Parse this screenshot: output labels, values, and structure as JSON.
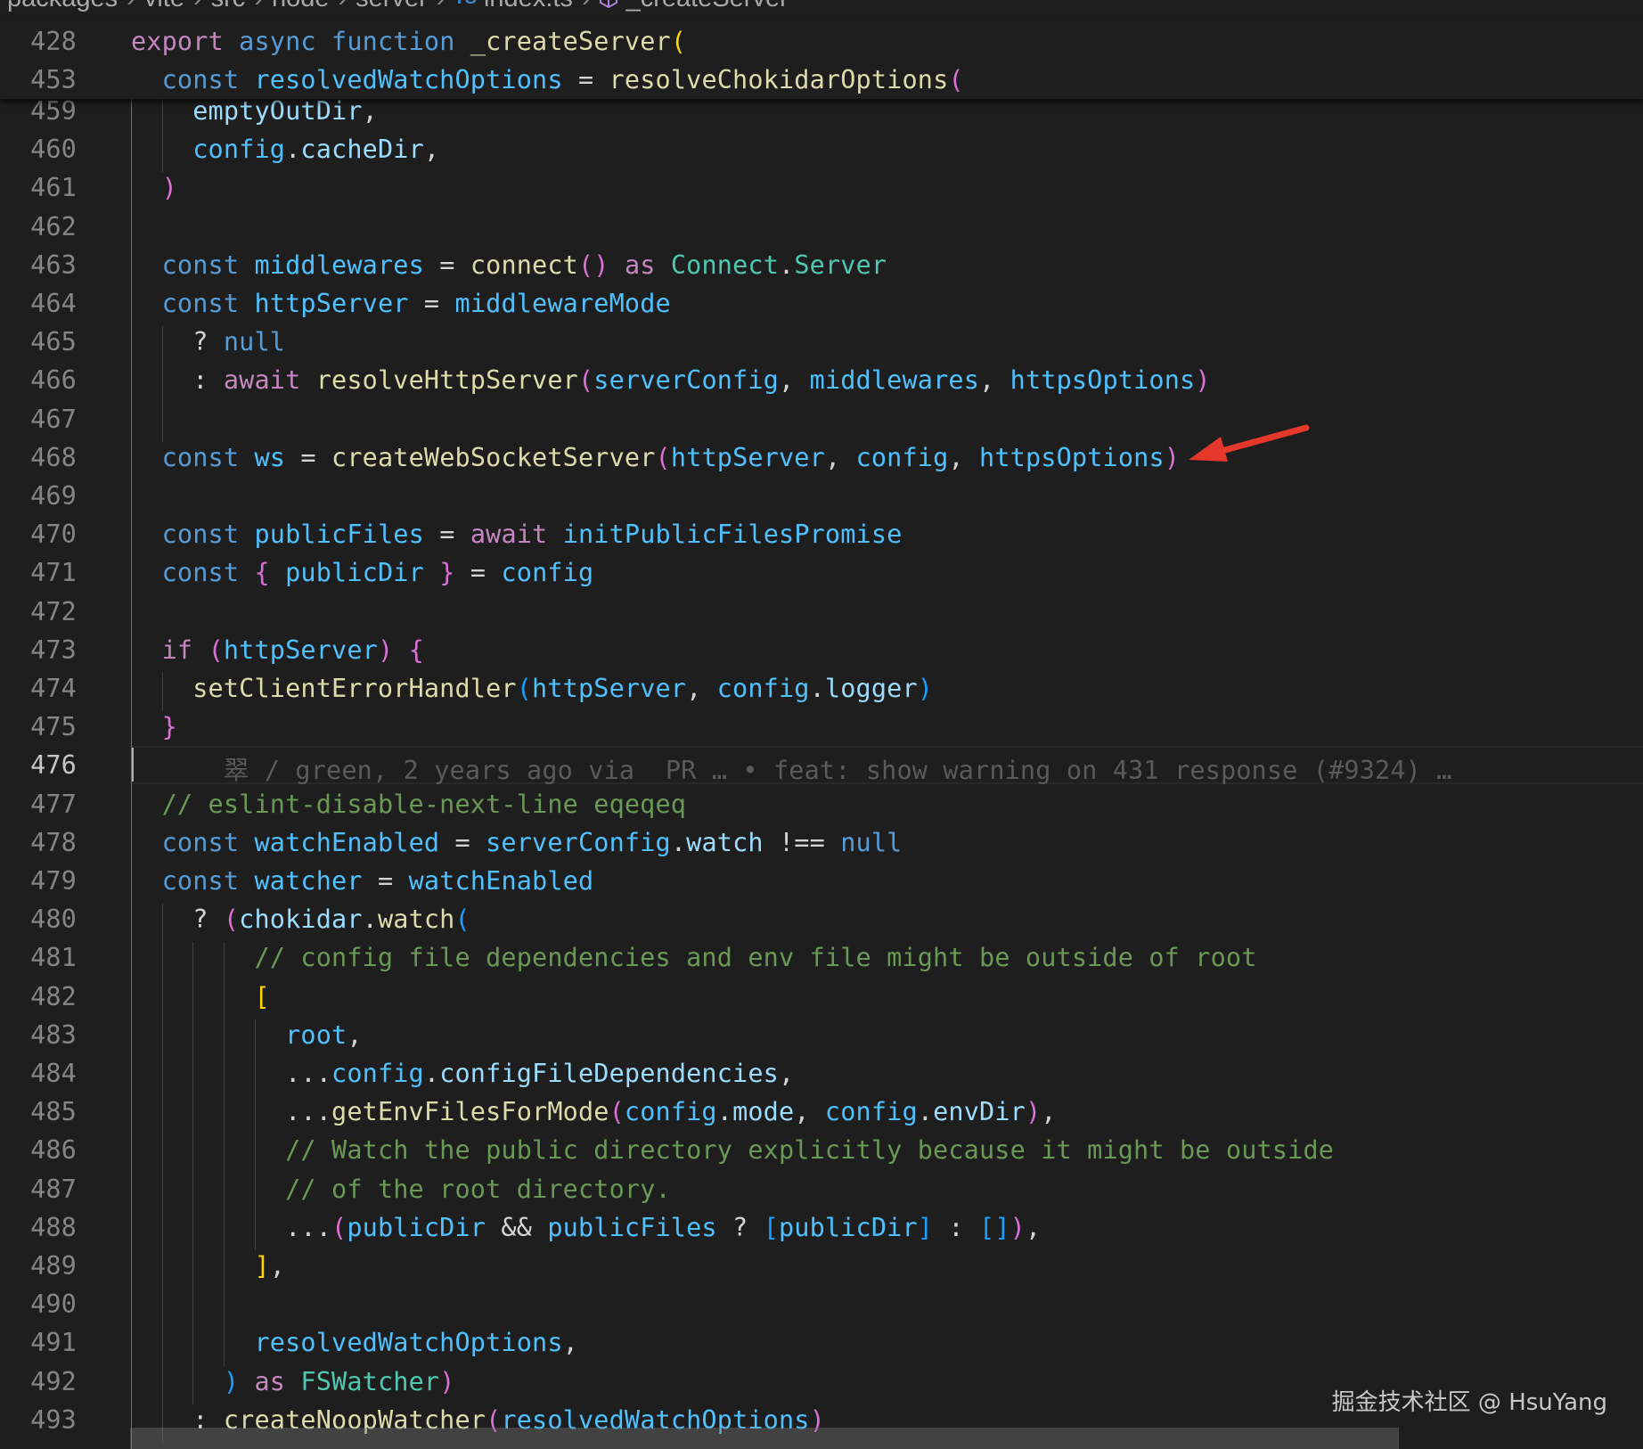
{
  "breadcrumb": {
    "segments": [
      "packages",
      "vite",
      "src",
      "node",
      "server"
    ],
    "ts_badge": "TS",
    "file": "index.ts",
    "symbol": "_createServer"
  },
  "sticky": [
    {
      "num": "428",
      "tokens": [
        [
          "ctl",
          "export"
        ],
        [
          "op",
          " "
        ],
        [
          "kw",
          "async"
        ],
        [
          "op",
          " "
        ],
        [
          "kw",
          "function"
        ],
        [
          "op",
          " "
        ],
        [
          "fn",
          "_createServer"
        ],
        [
          "b1",
          "("
        ]
      ]
    },
    {
      "num": "453",
      "tokens": [
        [
          "op",
          "  "
        ],
        [
          "kw",
          "const"
        ],
        [
          "op",
          " "
        ],
        [
          "cv",
          "resolvedWatchOptions"
        ],
        [
          "op",
          " = "
        ],
        [
          "fn",
          "resolveChokidarOptions"
        ],
        [
          "b2",
          "("
        ]
      ]
    }
  ],
  "lines": [
    {
      "num": "459",
      "tokens": [
        [
          "op",
          "    "
        ],
        [
          "v",
          "emptyOutDir"
        ],
        [
          "op",
          ","
        ]
      ]
    },
    {
      "num": "460",
      "tokens": [
        [
          "op",
          "    "
        ],
        [
          "cv",
          "config"
        ],
        [
          "op",
          "."
        ],
        [
          "v",
          "cacheDir"
        ],
        [
          "op",
          ","
        ]
      ]
    },
    {
      "num": "461",
      "tokens": [
        [
          "op",
          "  "
        ],
        [
          "b2",
          ")"
        ]
      ]
    },
    {
      "num": "462",
      "tokens": []
    },
    {
      "num": "463",
      "tokens": [
        [
          "op",
          "  "
        ],
        [
          "kw",
          "const"
        ],
        [
          "op",
          " "
        ],
        [
          "cv",
          "middlewares"
        ],
        [
          "op",
          " = "
        ],
        [
          "fn",
          "connect"
        ],
        [
          "b2",
          "()"
        ],
        [
          "op",
          " "
        ],
        [
          "ctl",
          "as"
        ],
        [
          "op",
          " "
        ],
        [
          "ty",
          "Connect"
        ],
        [
          "op",
          "."
        ],
        [
          "ty",
          "Server"
        ]
      ]
    },
    {
      "num": "464",
      "tokens": [
        [
          "op",
          "  "
        ],
        [
          "kw",
          "const"
        ],
        [
          "op",
          " "
        ],
        [
          "cv",
          "httpServer"
        ],
        [
          "op",
          " = "
        ],
        [
          "cv",
          "middlewareMode"
        ]
      ]
    },
    {
      "num": "465",
      "tokens": [
        [
          "op",
          "    ? "
        ],
        [
          "kw",
          "null"
        ]
      ]
    },
    {
      "num": "466",
      "tokens": [
        [
          "op",
          "    : "
        ],
        [
          "ctl",
          "await"
        ],
        [
          "op",
          " "
        ],
        [
          "fn",
          "resolveHttpServer"
        ],
        [
          "b2",
          "("
        ],
        [
          "cv",
          "serverConfig"
        ],
        [
          "op",
          ", "
        ],
        [
          "cv",
          "middlewares"
        ],
        [
          "op",
          ", "
        ],
        [
          "cv",
          "httpsOptions"
        ],
        [
          "b2",
          ")"
        ]
      ]
    },
    {
      "num": "467",
      "tokens": []
    },
    {
      "num": "468",
      "tokens": [
        [
          "op",
          "  "
        ],
        [
          "kw",
          "const"
        ],
        [
          "op",
          " "
        ],
        [
          "cv",
          "ws"
        ],
        [
          "op",
          " = "
        ],
        [
          "fn",
          "createWebSocketServer"
        ],
        [
          "b2",
          "("
        ],
        [
          "cv",
          "httpServer"
        ],
        [
          "op",
          ", "
        ],
        [
          "cv",
          "config"
        ],
        [
          "op",
          ", "
        ],
        [
          "cv",
          "httpsOptions"
        ],
        [
          "b2",
          ")"
        ]
      ]
    },
    {
      "num": "469",
      "tokens": []
    },
    {
      "num": "470",
      "tokens": [
        [
          "op",
          "  "
        ],
        [
          "kw",
          "const"
        ],
        [
          "op",
          " "
        ],
        [
          "cv",
          "publicFiles"
        ],
        [
          "op",
          " = "
        ],
        [
          "ctl",
          "await"
        ],
        [
          "op",
          " "
        ],
        [
          "cv",
          "initPublicFilesPromise"
        ]
      ]
    },
    {
      "num": "471",
      "tokens": [
        [
          "op",
          "  "
        ],
        [
          "kw",
          "const"
        ],
        [
          "op",
          " "
        ],
        [
          "b2",
          "{"
        ],
        [
          "op",
          " "
        ],
        [
          "cv",
          "publicDir"
        ],
        [
          "op",
          " "
        ],
        [
          "b2",
          "}"
        ],
        [
          "op",
          " = "
        ],
        [
          "cv",
          "config"
        ]
      ]
    },
    {
      "num": "472",
      "tokens": []
    },
    {
      "num": "473",
      "tokens": [
        [
          "op",
          "  "
        ],
        [
          "ctl",
          "if"
        ],
        [
          "op",
          " "
        ],
        [
          "b2",
          "("
        ],
        [
          "cv",
          "httpServer"
        ],
        [
          "b2",
          ")"
        ],
        [
          "op",
          " "
        ],
        [
          "b2",
          "{"
        ]
      ]
    },
    {
      "num": "474",
      "tokens": [
        [
          "op",
          "    "
        ],
        [
          "fn",
          "setClientErrorHandler"
        ],
        [
          "b3",
          "("
        ],
        [
          "cv",
          "httpServer"
        ],
        [
          "op",
          ", "
        ],
        [
          "cv",
          "config"
        ],
        [
          "op",
          "."
        ],
        [
          "v",
          "logger"
        ],
        [
          "b3",
          ")"
        ]
      ]
    },
    {
      "num": "475",
      "tokens": [
        [
          "op",
          "  "
        ],
        [
          "b2",
          "}"
        ]
      ]
    },
    {
      "num": "476",
      "active": true,
      "tokens": [
        [
          "op",
          "      "
        ],
        [
          "blame",
          "翠 / green, 2 years ago via  PR … • feat: show warning on 431 response (#9324) …"
        ]
      ]
    },
    {
      "num": "477",
      "tokens": [
        [
          "op",
          "  "
        ],
        [
          "cm",
          "// eslint-disable-next-line eqeqeq"
        ]
      ]
    },
    {
      "num": "478",
      "tokens": [
        [
          "op",
          "  "
        ],
        [
          "kw",
          "const"
        ],
        [
          "op",
          " "
        ],
        [
          "cv",
          "watchEnabled"
        ],
        [
          "op",
          " = "
        ],
        [
          "cv",
          "serverConfig"
        ],
        [
          "op",
          "."
        ],
        [
          "v",
          "watch"
        ],
        [
          "op",
          " !== "
        ],
        [
          "kw",
          "null"
        ]
      ]
    },
    {
      "num": "479",
      "tokens": [
        [
          "op",
          "  "
        ],
        [
          "kw",
          "const"
        ],
        [
          "op",
          " "
        ],
        [
          "cv",
          "watcher"
        ],
        [
          "op",
          " = "
        ],
        [
          "cv",
          "watchEnabled"
        ]
      ]
    },
    {
      "num": "480",
      "tokens": [
        [
          "op",
          "    ? "
        ],
        [
          "b2",
          "("
        ],
        [
          "v",
          "chokidar"
        ],
        [
          "op",
          "."
        ],
        [
          "fn",
          "watch"
        ],
        [
          "b3",
          "("
        ]
      ]
    },
    {
      "num": "481",
      "tokens": [
        [
          "op",
          "        "
        ],
        [
          "cm",
          "// config file dependencies and env file might be outside of root"
        ]
      ]
    },
    {
      "num": "482",
      "tokens": [
        [
          "op",
          "        "
        ],
        [
          "b1",
          "["
        ]
      ]
    },
    {
      "num": "483",
      "tokens": [
        [
          "op",
          "          "
        ],
        [
          "cv",
          "root"
        ],
        [
          "op",
          ","
        ]
      ]
    },
    {
      "num": "484",
      "tokens": [
        [
          "op",
          "          ..."
        ],
        [
          "cv",
          "config"
        ],
        [
          "op",
          "."
        ],
        [
          "v",
          "configFileDependencies"
        ],
        [
          "op",
          ","
        ]
      ]
    },
    {
      "num": "485",
      "tokens": [
        [
          "op",
          "          ..."
        ],
        [
          "fn",
          "getEnvFilesForMode"
        ],
        [
          "b2",
          "("
        ],
        [
          "cv",
          "config"
        ],
        [
          "op",
          "."
        ],
        [
          "v",
          "mode"
        ],
        [
          "op",
          ", "
        ],
        [
          "cv",
          "config"
        ],
        [
          "op",
          "."
        ],
        [
          "v",
          "envDir"
        ],
        [
          "b2",
          ")"
        ],
        [
          "op",
          ","
        ]
      ]
    },
    {
      "num": "486",
      "tokens": [
        [
          "op",
          "          "
        ],
        [
          "cm",
          "// Watch the public directory explicitly because it might be outside"
        ]
      ]
    },
    {
      "num": "487",
      "tokens": [
        [
          "op",
          "          "
        ],
        [
          "cm",
          "// of the root directory."
        ]
      ]
    },
    {
      "num": "488",
      "tokens": [
        [
          "op",
          "          ..."
        ],
        [
          "b2",
          "("
        ],
        [
          "cv",
          "publicDir"
        ],
        [
          "op",
          " && "
        ],
        [
          "cv",
          "publicFiles"
        ],
        [
          "op",
          " ? "
        ],
        [
          "b3",
          "["
        ],
        [
          "cv",
          "publicDir"
        ],
        [
          "b3",
          "]"
        ],
        [
          "op",
          " : "
        ],
        [
          "b3",
          "[]"
        ],
        [
          "b2",
          ")"
        ],
        [
          "op",
          ","
        ]
      ]
    },
    {
      "num": "489",
      "tokens": [
        [
          "op",
          "        "
        ],
        [
          "b1",
          "]"
        ],
        [
          "op",
          ","
        ]
      ]
    },
    {
      "num": "490",
      "tokens": []
    },
    {
      "num": "491",
      "tokens": [
        [
          "op",
          "        "
        ],
        [
          "cv",
          "resolvedWatchOptions"
        ],
        [
          "op",
          ","
        ]
      ]
    },
    {
      "num": "492",
      "tokens": [
        [
          "op",
          "      "
        ],
        [
          "b3",
          ")"
        ],
        [
          "op",
          " "
        ],
        [
          "ctl",
          "as"
        ],
        [
          "op",
          " "
        ],
        [
          "ty",
          "FSWatcher"
        ],
        [
          "b2",
          ")"
        ]
      ]
    },
    {
      "num": "493",
      "tokens": [
        [
          "op",
          "    : "
        ],
        [
          "fn",
          "createNoopWatcher"
        ],
        [
          "b2",
          "("
        ],
        [
          "cv",
          "resolvedWatchOptions"
        ],
        [
          "b2",
          ")"
        ]
      ]
    }
  ],
  "watermark": "掘金技术社区 @ HsuYang",
  "arrow_color": "#e5382c"
}
